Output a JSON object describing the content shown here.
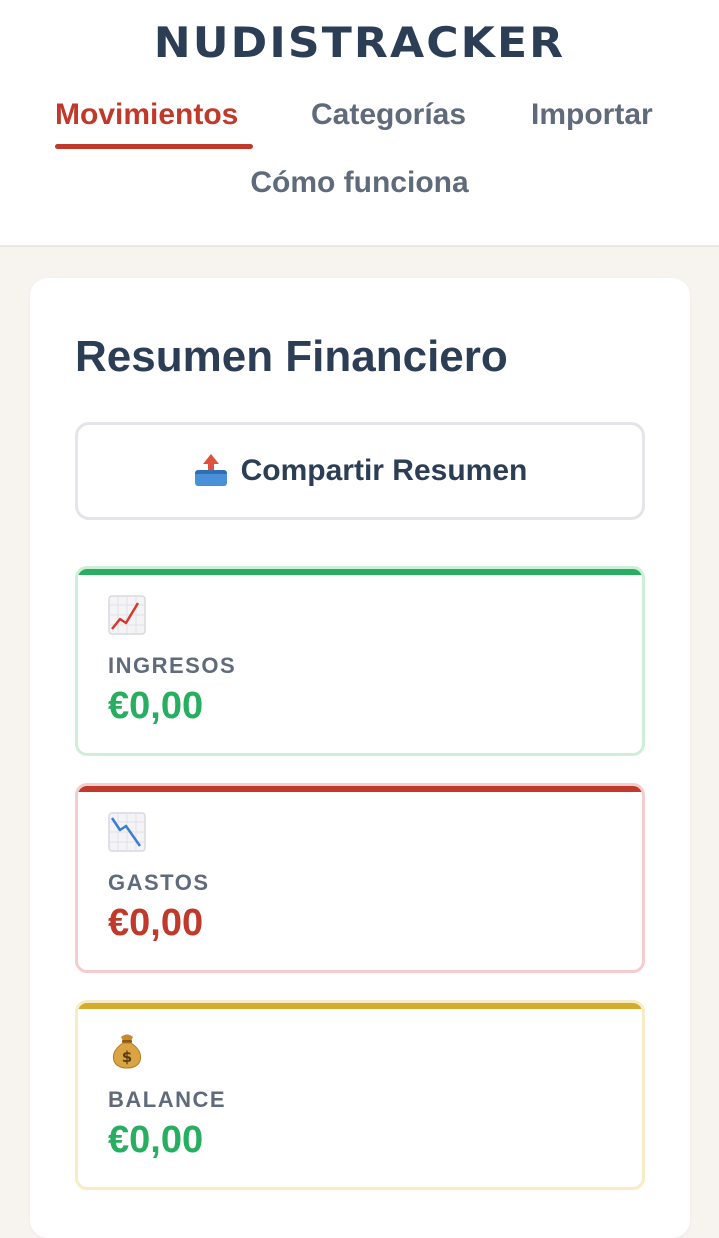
{
  "app": {
    "logo": "NUDISTRACKER"
  },
  "nav": {
    "items": [
      {
        "label": "Movimientos",
        "active": true
      },
      {
        "label": "Categorías",
        "active": false
      },
      {
        "label": "Importar",
        "active": false
      },
      {
        "label": "Cómo funciona",
        "active": false
      }
    ]
  },
  "summary": {
    "title": "Resumen Financiero",
    "share_label": "Compartir Resumen",
    "share_icon": "outbox-tray-icon",
    "cards": [
      {
        "icon": "chart-increasing-icon",
        "label": "INGRESOS",
        "value": "€0,00",
        "accent": "#27ae60",
        "value_color": "#27ae60"
      },
      {
        "icon": "chart-decreasing-icon",
        "label": "GASTOS",
        "value": "€0,00",
        "accent": "#c0392b",
        "value_color": "#c0392b"
      },
      {
        "icon": "money-bag-icon",
        "label": "BALANCE",
        "value": "€0,00",
        "accent": "#d4ac2b",
        "value_color": "#27ae60"
      }
    ]
  }
}
